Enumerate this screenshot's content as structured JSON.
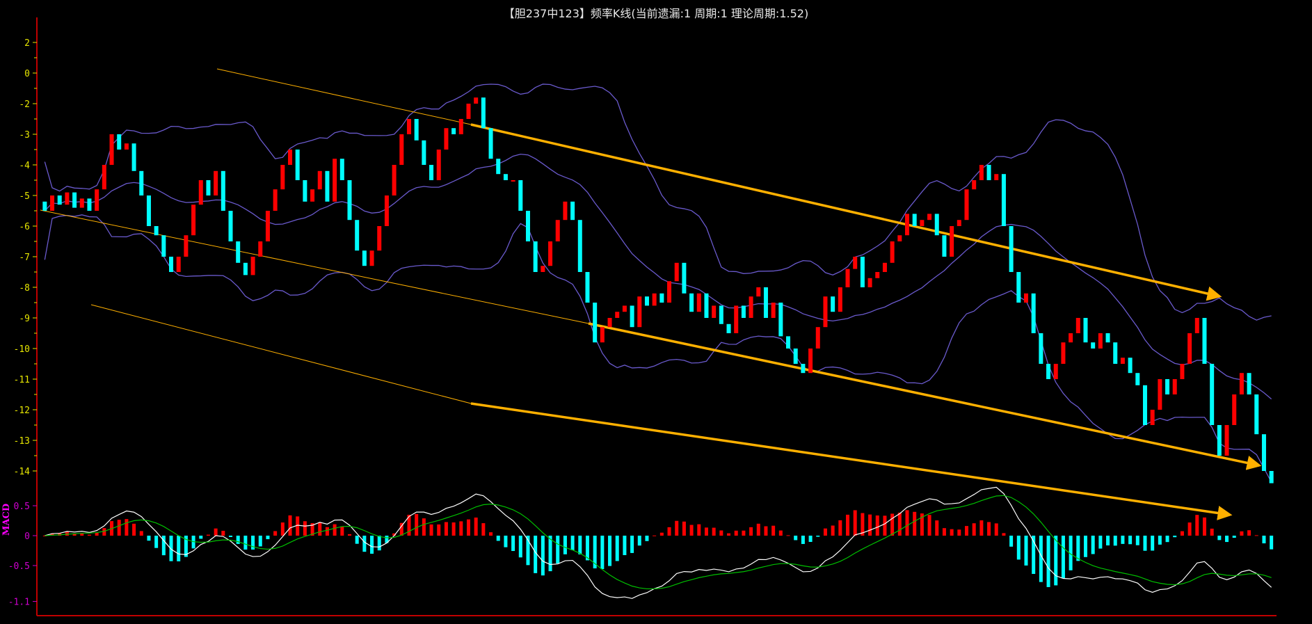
{
  "title": "【胆237中123】频率K线(当前遗漏:1 周期:1 理论周期:1.52)",
  "colors": {
    "up": "#ff0000",
    "down": "#00ffff",
    "band": "#6a5acd",
    "trend": "#ffb000",
    "axis": "#c00000",
    "price_labels": "#e6e600",
    "macd_labels": "#d000d0",
    "dif": "#ffffff",
    "dea": "#00c000"
  },
  "chart_data": [
    {
      "type": "candlestick",
      "title": "频率K线",
      "ytick_labels": [
        "2",
        "0",
        "-2",
        "-3",
        "-4",
        "-5",
        "-6",
        "-7",
        "-8",
        "-9",
        "-10",
        "-11",
        "-12",
        "-13",
        "-14"
      ],
      "ytick_values": [
        2,
        0,
        -2,
        -3,
        -4,
        -5,
        -6,
        -7,
        -8,
        -9,
        -10,
        -11,
        -12,
        -13,
        -14
      ],
      "overlays": [
        "bollinger upper",
        "bollinger middle",
        "bollinger lower",
        "trend lines (3, descending, with arrows)"
      ],
      "closes": [
        -5.5,
        -5.0,
        -5.3,
        -4.9,
        -5.4,
        -5.1,
        -5.5,
        -4.8,
        -4.0,
        -3.0,
        -3.5,
        -3.3,
        -4.2,
        -5.0,
        -6.0,
        -6.3,
        -7.0,
        -7.5,
        -7.0,
        -6.3,
        -5.3,
        -4.5,
        -5.0,
        -4.2,
        -5.5,
        -6.5,
        -7.2,
        -7.6,
        -7.0,
        -6.5,
        -5.5,
        -4.8,
        -4.0,
        -3.5,
        -4.5,
        -5.2,
        -4.8,
        -4.2,
        -5.2,
        -3.8,
        -4.5,
        -5.8,
        -6.8,
        -7.3,
        -6.8,
        -6.0,
        -5.0,
        -4.0,
        -3.0,
        -2.5,
        -3.2,
        -4.0,
        -4.5,
        -3.5,
        -2.8,
        -3.0,
        -2.5,
        -2.0,
        -1.6,
        -2.8,
        -3.8,
        -4.3,
        -4.5,
        -4.5,
        -5.5,
        -6.5,
        -7.5,
        -7.3,
        -6.5,
        -5.8,
        -5.2,
        -5.8,
        -7.5,
        -8.5,
        -9.8,
        -9.3,
        -9.0,
        -8.8,
        -8.6,
        -9.3,
        -8.3,
        -8.6,
        -8.2,
        -8.5,
        -7.8,
        -7.2,
        -8.2,
        -8.8,
        -8.2,
        -9.0,
        -8.6,
        -9.2,
        -9.5,
        -8.6,
        -9.0,
        -8.3,
        -8.0,
        -9.0,
        -8.5,
        -9.6,
        -10.0,
        -10.5,
        -10.8,
        -10.0,
        -9.3,
        -8.3,
        -8.8,
        -8.0,
        -7.4,
        -7.0,
        -8.0,
        -7.7,
        -7.5,
        -7.2,
        -6.5,
        -6.3,
        -5.6,
        -6.0,
        -5.8,
        -5.6,
        -6.3,
        -7.0,
        -6.0,
        -5.8,
        -4.8,
        -4.5,
        -4.0,
        -4.5,
        -4.3,
        -6.0,
        -7.5,
        -8.5,
        -8.2,
        -9.5,
        -10.5,
        -11.0,
        -10.5,
        -9.8,
        -9.5,
        -9.0,
        -9.8,
        -10.0,
        -9.5,
        -9.8,
        -10.5,
        -10.3,
        -10.8,
        -11.2,
        -12.5,
        -12.0,
        -11.0,
        -11.5,
        -11.0,
        -10.5,
        -9.5,
        -9.0,
        -10.5,
        -12.5,
        -13.5,
        -12.5,
        -11.5,
        -10.8,
        -11.5,
        -12.8,
        -14.0,
        -14.4
      ]
    },
    {
      "type": "bar+line",
      "title": "MACD",
      "ytick_labels": [
        "0.5",
        "0",
        "-0.5",
        "-1.1"
      ],
      "ytick_values": [
        0.5,
        0,
        -0.5,
        -1.1
      ],
      "series": [
        "DIF (white)",
        "DEA (green)",
        "MACD histogram (red/cyan)"
      ]
    }
  ]
}
